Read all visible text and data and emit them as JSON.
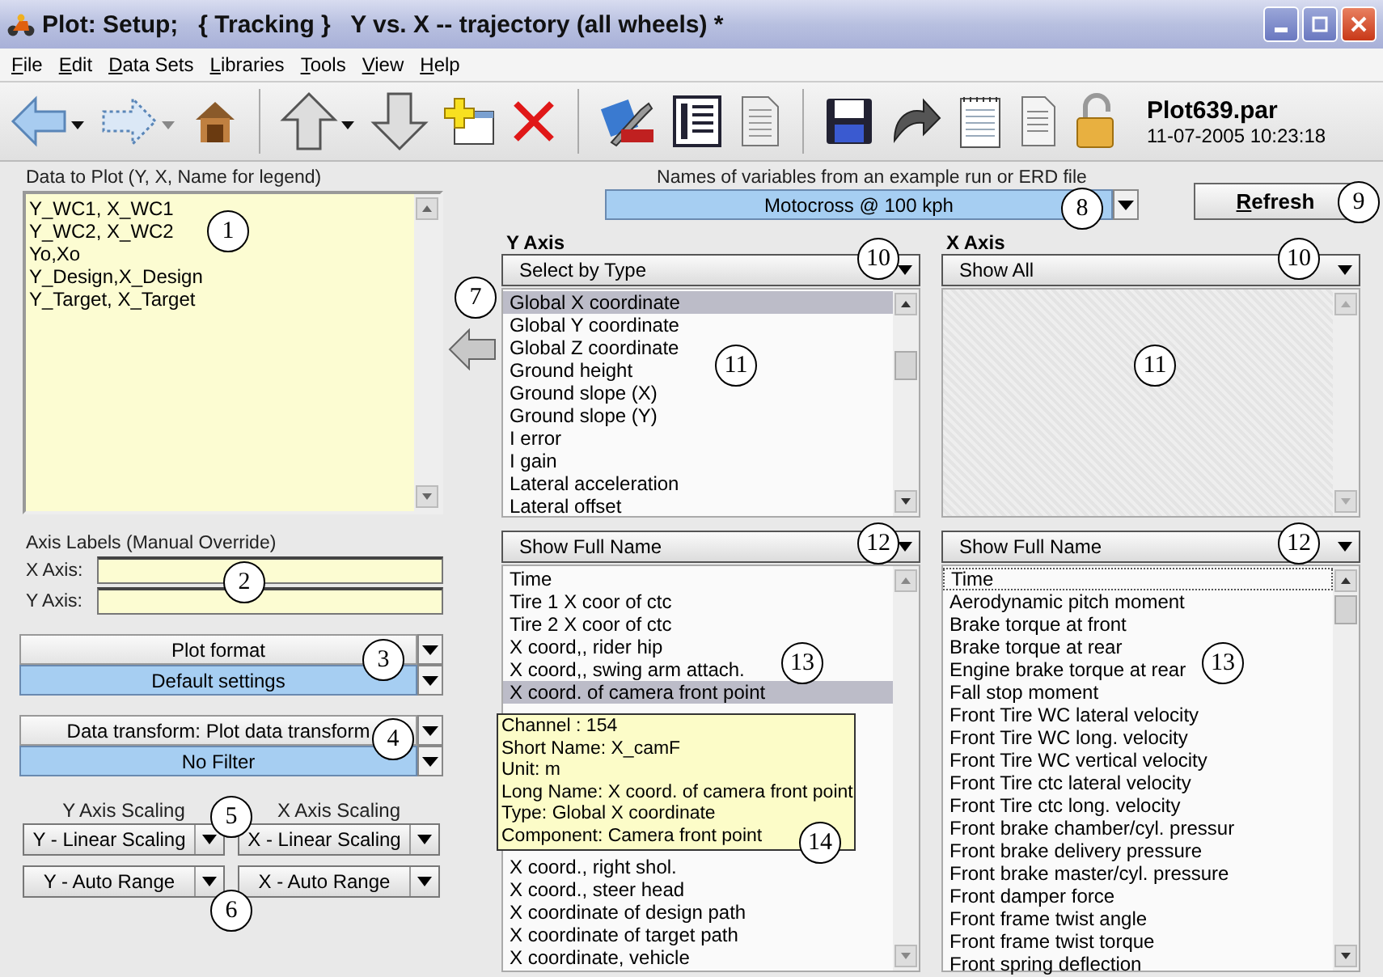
{
  "window": {
    "title": "Plot: Setup;   { Tracking }   Y vs. X -- trajectory (all wheels) *"
  },
  "menu": [
    "File",
    "Edit",
    "Data Sets",
    "Libraries",
    "Tools",
    "View",
    "Help"
  ],
  "toolbar": {
    "history": [
      {
        "disabled": false
      },
      {
        "disabled": true
      }
    ],
    "file_name": "Plot639.par",
    "file_date": "11-07-2005 10:23:18"
  },
  "data_to_plot": {
    "label": "Data to Plot  (Y, X, Name for legend)",
    "lines": [
      "Y_WC1, X_WC1",
      "Y_WC2, X_WC2",
      "Yo,Xo",
      "Y_Design,X_Design",
      "Y_Target, X_Target"
    ]
  },
  "axis_labels": {
    "label": "Axis Labels (Manual Override)",
    "fields": [
      {
        "label": "X Axis:"
      },
      {
        "label": "Y Axis:"
      }
    ]
  },
  "plot_format": {
    "title": "Plot format",
    "value": "Default settings"
  },
  "data_transform": {
    "title": "Data transform: Plot data transform",
    "value": "No Filter"
  },
  "scaling": {
    "headers": [
      "Y Axis Scaling",
      "X Axis Scaling"
    ],
    "buttons": [
      "Y - Linear Scaling",
      "X - Linear Scaling",
      "Y - Auto Range",
      "X - Auto Range"
    ]
  },
  "example_run": {
    "label": "Names of variables from an example run or ERD file",
    "value": "Motocross @ 100 kph"
  },
  "refresh": "Refresh",
  "y_axis": {
    "title": "Y Axis",
    "type_filter": "Select by Type",
    "types": [
      {
        "label": "Global X coordinate",
        "selected": true
      },
      {
        "label": "Global Y coordinate",
        "selected": false
      },
      {
        "label": "Global Z coordinate",
        "selected": false
      },
      {
        "label": "Ground height",
        "selected": false
      },
      {
        "label": "Ground slope (X)",
        "selected": false
      },
      {
        "label": "Ground slope (Y)",
        "selected": false
      },
      {
        "label": "I error",
        "selected": false
      },
      {
        "label": "I gain",
        "selected": false
      },
      {
        "label": "Lateral acceleration",
        "selected": false
      },
      {
        "label": "Lateral offset",
        "selected": false
      }
    ],
    "name_mode": "Show Full Name",
    "names": [
      {
        "label": "Time",
        "selected": false
      },
      {
        "label": "Tire 1 X coor of ctc",
        "selected": false
      },
      {
        "label": "Tire 2 X coor of ctc",
        "selected": false
      },
      {
        "label": "X coord,, rider hip",
        "selected": false
      },
      {
        "label": "X coord,, swing arm attach.",
        "selected": false
      },
      {
        "label": "X coord. of camera front point",
        "selected": true
      }
    ],
    "names_after": [
      {
        "label": "X coord., right shol.",
        "selected": false
      },
      {
        "label": "X coord., steer head",
        "selected": false
      },
      {
        "label": "X coordinate of design path",
        "selected": false
      },
      {
        "label": "X coordinate of target path",
        "selected": false
      },
      {
        "label": "X coordinate, vehicle",
        "selected": false
      }
    ],
    "tooltip": [
      "Channel : 154",
      "Short Name: X_camF",
      "Unit: m",
      "Long Name: X coord. of camera front point",
      "Type: Global X coordinate",
      "Component: Camera front point"
    ]
  },
  "x_axis": {
    "title": "X Axis",
    "type_filter": "Show All",
    "name_mode": "Show Full Name",
    "names": [
      {
        "label": "Time",
        "focused": true
      },
      {
        "label": "Aerodynamic pitch moment",
        "focused": false
      },
      {
        "label": "Brake torque at front",
        "focused": false
      },
      {
        "label": "Brake torque at rear",
        "focused": false
      },
      {
        "label": "Engine brake torque at rear",
        "focused": false
      },
      {
        "label": "Fall stop moment",
        "focused": false
      },
      {
        "label": "Front Tire WC lateral velocity",
        "focused": false
      },
      {
        "label": "Front Tire WC long. velocity",
        "focused": false
      },
      {
        "label": "Front Tire WC vertical velocity",
        "focused": false
      },
      {
        "label": "Front Tire ctc lateral velocity",
        "focused": false
      },
      {
        "label": "Front Tire ctc long. velocity",
        "focused": false
      },
      {
        "label": "Front brake chamber/cyl. pressur",
        "focused": false
      },
      {
        "label": "Front brake delivery pressure",
        "focused": false
      },
      {
        "label": "Front brake master/cyl. pressure",
        "focused": false
      },
      {
        "label": "Front damper force",
        "focused": false
      },
      {
        "label": "Front frame twist angle",
        "focused": false
      },
      {
        "label": "Front frame twist torque",
        "focused": false
      },
      {
        "label": "Front spring deflection",
        "focused": false
      }
    ]
  },
  "callouts": [
    "1",
    "2",
    "3",
    "4",
    "5",
    "6",
    "7",
    "8",
    "9",
    "10",
    "10",
    "11",
    "11",
    "12",
    "12",
    "13",
    "13",
    "14"
  ]
}
